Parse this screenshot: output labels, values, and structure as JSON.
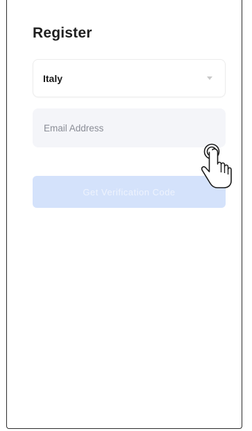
{
  "header": {
    "title": "Register"
  },
  "country": {
    "selected": "Italy"
  },
  "email": {
    "placeholder": "Email Address",
    "value": ""
  },
  "actions": {
    "get_code_label": "Get Verification Code"
  },
  "colors": {
    "button_disabled": "#d4e2fb",
    "field_background": "#f4f5f9",
    "title_text": "#1f1f1f"
  },
  "icons": {
    "dropdown": "chevron-down-icon",
    "cursor": "hand-pointer-icon"
  }
}
